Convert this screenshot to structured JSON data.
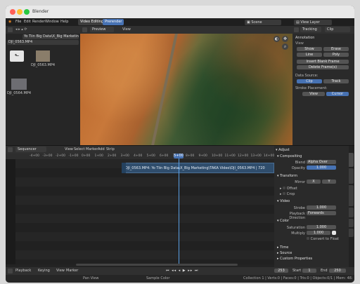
{
  "window": {
    "title": "Blender"
  },
  "menu": {
    "items": [
      "File",
      "Edit",
      "Render",
      "Window",
      "Help"
    ]
  },
  "workspace_tabs": [
    "Video Editing",
    "Prerender"
  ],
  "topbar": {
    "scene_label": "Scene",
    "view_layer_label": "View Layer"
  },
  "file_browser": {
    "path": "Yo Tiin Big Data\\X_Big Marketing\\TAKA Video\\",
    "selected_file": "DJI_0563.MP4",
    "files": [
      {
        "name": "",
        "kind": "parent-folder"
      },
      {
        "name": "DJI_0563.MP4",
        "kind": "video"
      },
      {
        "name": "DJI_0564.MP4",
        "kind": "video"
      }
    ]
  },
  "preview": {
    "header_mode": "Preview",
    "view_menu": "View"
  },
  "tracking_panel": {
    "header_tab": "Tracking",
    "clip_label": "Clip",
    "annotation_title": "Annotation",
    "view_title": "View",
    "buttons": [
      "Show",
      "Erase",
      "Line",
      "Poly"
    ],
    "insert_blank_frame": "Insert Blank Frame",
    "delete_frame": "Delete Frame(s)",
    "data_source_label": "Data Source:",
    "clip_btn": "Clip",
    "track_btn": "Track",
    "stroke_placement_label": "Stroke Placement:",
    "view_btn": "View",
    "cursor_btn": "Cursor"
  },
  "sequencer": {
    "editor_name": "Sequencer",
    "menu": [
      "View",
      "Select",
      "Marker",
      "Add",
      "Strip"
    ],
    "timeline_ticks": [
      "-4+00",
      "-3+00",
      "-2+00",
      "-1+00",
      "0+00",
      "1+00",
      "2+00",
      "3+00",
      "4+00",
      "5+00",
      "6+00",
      "7+00",
      "8+00",
      "9+00",
      "10+00",
      "11+00",
      "12+00",
      "13+00",
      "14+00"
    ],
    "current_frame": "5+00",
    "strip_label": "DJI_0563.MP4: Yo Tiin Big Data\\X_Big Marketing\\TAKA Video\\DJI_0563.MP4 | 720"
  },
  "strip_properties": {
    "adjust_title": "Adjust",
    "compositing_title": "Compositing",
    "blend_label": "Blend",
    "blend_value": "Alpha Over",
    "opacity_label": "Opacity",
    "opacity_value": "1.000",
    "transform_title": "Transform",
    "mirror_label": "Mirror",
    "mirror_x": "X",
    "mirror_y": "Y",
    "offset_label": "Offset",
    "crop_label": "Crop",
    "video_title": "Video",
    "strobe_label": "Strobe",
    "strobe_value": "1.000",
    "playback_label": "Playback Direction",
    "playback_value": "Forwards",
    "color_title": "Color",
    "saturation_label": "Saturation",
    "saturation_value": "1.000",
    "multiply_label": "Multiply",
    "multiply_value": "1.000",
    "convert_label": "Convert to Float",
    "time_title": "Time",
    "source_title": "Source",
    "custom_props_title": "Custom Properties",
    "tabs": [
      "Strip",
      "Modifiers",
      "Proxy & Cache",
      "Scene",
      "Tool",
      "View"
    ]
  },
  "playback_bar": {
    "playback": "Playback",
    "keying": "Keying",
    "view": "View",
    "marker": "Marker",
    "frame_current": "253",
    "start_label": "Start",
    "start_value": "1",
    "end_label": "End",
    "end_value": "250"
  },
  "statusbar": {
    "left": "Pan View",
    "middle": "Sample Color",
    "right": "Collection 1 | Verts:0 | Faces:0 | Tris:0 | Objects:0/1 | Mem: 48.6 MiB | 2.92.0 ..."
  },
  "colors": {
    "accent_blue": "#4772b3",
    "strip_blue": "#2f4d6c",
    "playhead": "#5aa0e6"
  }
}
